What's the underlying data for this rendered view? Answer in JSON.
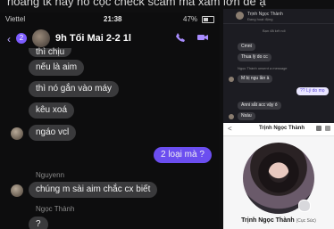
{
  "caption": "hoàng tk hay nó cọc check scam mà xấm lớn để ạ",
  "left": {
    "status": {
      "carrier": "Viettel",
      "time": "21:38",
      "battery": "47%"
    },
    "header": {
      "back": "‹",
      "badge": "2",
      "title": "9h Tối Mai 2-2 1l"
    },
    "icons": [
      "phone-icon",
      "video-icon"
    ],
    "messages": [
      {
        "text": "thì chịu",
        "from": "other"
      },
      {
        "text": "nếu là aim",
        "from": "other"
      },
      {
        "text": "thì nó gắn vào máy",
        "from": "other"
      },
      {
        "text": "kêu xoá",
        "from": "other"
      },
      {
        "text": "ngáo vcl",
        "from": "other"
      },
      {
        "text": "2 loại mà ?",
        "from": "me"
      },
      {
        "sender": "Nguyenn",
        "text": "chúng m sài aim chắc cx biết",
        "from": "other"
      },
      {
        "sender": "Ngọc Thành",
        "text": "?",
        "from": "other"
      }
    ]
  },
  "right_top": {
    "header": {
      "name": "Trịnh Ngọc Thành",
      "sub": "Đang hoạt động"
    },
    "system_1": "Bạn đã kết nối",
    "messages": [
      {
        "text": "Cmnt",
        "from": "other"
      },
      {
        "text": "Thua lỳ do cc",
        "from": "other"
      },
      {
        "text": "Ngọc Thành unsent a message",
        "from": "system"
      },
      {
        "text": "M bị ngu lần à",
        "from": "other"
      },
      {
        "text": "?? Lý do mọ",
        "from": "me"
      },
      {
        "text": "Anni sắt acc vậy ó",
        "from": "other"
      },
      {
        "text": "Nsàu",
        "from": "other"
      }
    ]
  },
  "right_bottom": {
    "back": "<",
    "title": "Trịnh Ngọc Thành",
    "name": "Trịnh Ngọc Thành",
    "nick": "(Cục Súc)"
  }
}
